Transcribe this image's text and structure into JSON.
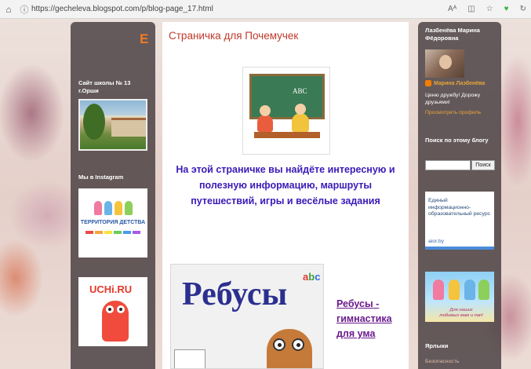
{
  "browser": {
    "url": "https://gecheleva.blogspot.com/p/blog-page_17.html",
    "icons": [
      "home-icon",
      "site-info-icon",
      "read-aloud-icon",
      "split-screen-icon",
      "favorites-icon",
      "extension-icon",
      "refresh-icon"
    ]
  },
  "left_sidebar": {
    "logo_letter": "E",
    "school_title": "Сайт школы № 13 г.Орши",
    "instagram_title": "Мы в Instagram",
    "instagram_image_text": "ТЕРРИТОРИЯ ДЕТСТВА",
    "uchi_image_text": "UCHi.RU"
  },
  "main": {
    "page_title": "Страничка для Почемучек",
    "classroom_board_text": "ABC",
    "intro_text": "На этой страничке вы найдёте интересную и полезную информацию, маршруты путешествий, игры и весёлые задания",
    "rebus_image_text": "Ребусы",
    "rebus_abc": [
      "a",
      "b",
      "c"
    ],
    "rebus_link": "Ребусы - гимнастика для ума"
  },
  "right_sidebar": {
    "author_name": "Лазбенёва Марина Фёдоровна",
    "profile_name": "Марина Лазбенёва",
    "about": "Ценю дружбу! Дорожу друзьями!",
    "profile_link": "Просмотреть профиль",
    "search_title": "Поиск по этому блогу",
    "search_placeholder": "",
    "search_button": "Поиск",
    "banner_text": "Единый информационно-образовательный ресурс",
    "banner_site": "aior.by",
    "kids_banner_text": "Для наших любимых мам и пап!",
    "labels_title": "Ярлыки",
    "label_item": "Безопасность"
  },
  "colors": {
    "title_red": "#c0392b",
    "intro_blue": "#3b1ab8",
    "link_purple": "#6a1a8c",
    "sidebar_link": "#e8a43a"
  }
}
